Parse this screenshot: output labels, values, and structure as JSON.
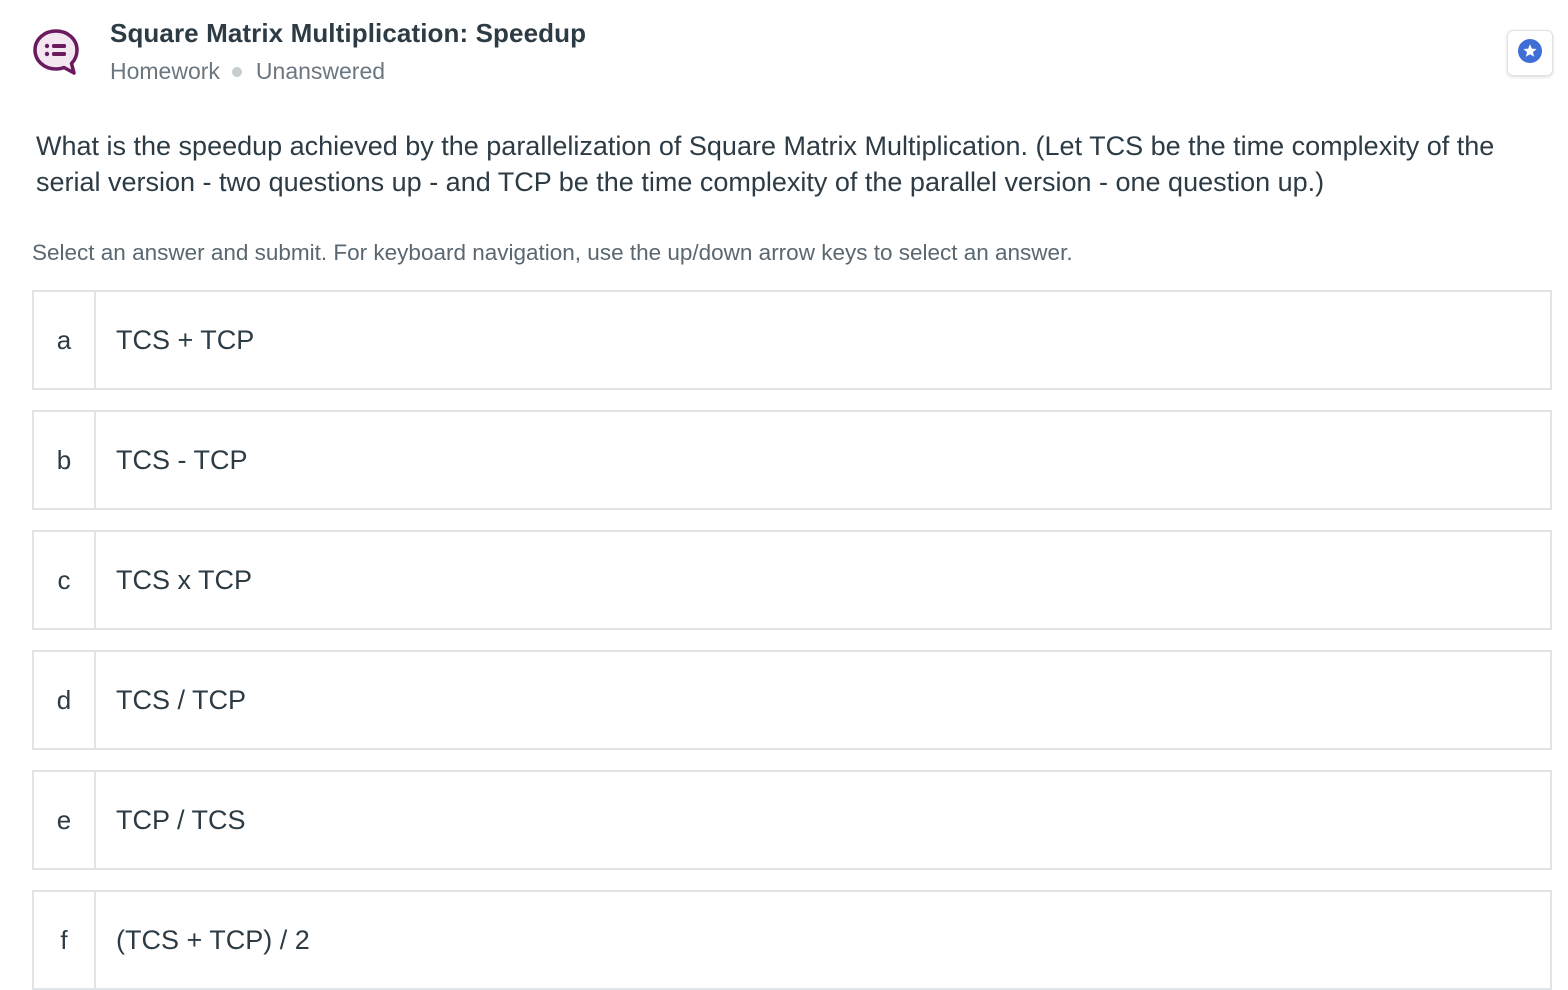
{
  "header": {
    "title": "Square Matrix Multiplication: Speedup",
    "category": "Homework",
    "status": "Unanswered",
    "icon": "chat-list-icon",
    "accent_color": "#6a1b5f"
  },
  "bookmark": {
    "icon": "star-icon",
    "color": "#3f6fd6"
  },
  "question": {
    "text": "What is the speedup achieved by the parallelization of Square Matrix Multiplication. (Let TCS be the time complexity of the serial version - two questions up - and TCP be the time complexity of the parallel version - one question up.)"
  },
  "instructions": "Select an answer and submit. For keyboard navigation, use the up/down arrow keys to select an answer.",
  "answers": [
    {
      "letter": "a",
      "text": "TCS + TCP"
    },
    {
      "letter": "b",
      "text": "TCS - TCP"
    },
    {
      "letter": "c",
      "text": "TCS x TCP"
    },
    {
      "letter": "d",
      "text": "TCS / TCP"
    },
    {
      "letter": "e",
      "text": "TCP / TCS"
    },
    {
      "letter": "f",
      "text": "(TCS + TCP) / 2"
    }
  ]
}
